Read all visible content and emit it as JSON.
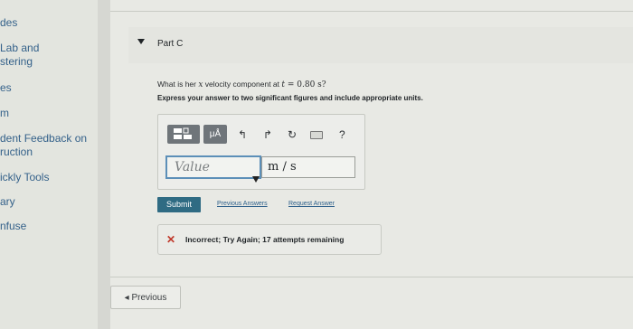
{
  "sidebar": {
    "items": [
      {
        "lines": [
          "des"
        ]
      },
      {
        "lines": [
          "Lab and",
          "stering"
        ]
      },
      {
        "lines": [
          "es"
        ]
      },
      {
        "lines": [
          "m"
        ]
      },
      {
        "lines": [
          "dent Feedback on",
          "ruction"
        ]
      },
      {
        "lines": [
          "ickly Tools"
        ]
      },
      {
        "lines": [
          "ary"
        ]
      },
      {
        "lines": [
          "nfuse"
        ]
      }
    ]
  },
  "part": {
    "label": "Part C"
  },
  "question": {
    "prefix": "What is her ",
    "var_x": "x",
    "middle": " velocity component at ",
    "var_t": "t",
    "equals": " = 0.80 s?",
    "instruction": "Express your answer to two significant figures and include appropriate units."
  },
  "toolbar": {
    "mu_label": "μÅ",
    "help_label": "?"
  },
  "answer": {
    "value_placeholder": "Value",
    "unit_value": "m / s"
  },
  "actions": {
    "submit_label": "Submit",
    "previous_answers_label": "Previous Answers",
    "request_answer_label": "Request Answer"
  },
  "feedback": {
    "icon": "x-icon",
    "message": "Incorrect; Try Again; 17 attempts remaining",
    "color": "#c0392b"
  },
  "navigation": {
    "previous_label": "◂ Previous"
  },
  "colors": {
    "submit_bg": "#2f6b83",
    "link": "#2c5f8a",
    "input_border": "#5c8fb8"
  }
}
